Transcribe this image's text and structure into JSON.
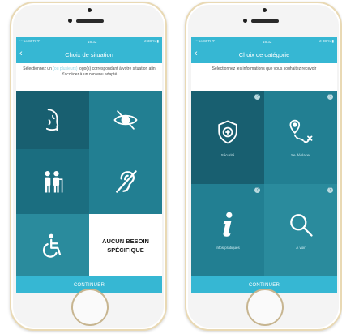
{
  "screen_left": {
    "status": {
      "left": "•••oo SFR ᯤ",
      "time": "16:32",
      "right": "≠ 38 % ▮"
    },
    "title": "Choix de situation",
    "intro_before": "Sélectionnez un",
    "intro_soft": "(ou plusieurs)",
    "intro_after": "logo(s) correspondant à votre situation afin d'accéder à un contenu adapté",
    "tiles": [
      {
        "icon": "face-profile-icon"
      },
      {
        "icon": "eye-icon"
      },
      {
        "icon": "elderly-couple-icon"
      },
      {
        "icon": "hearing-impaired-icon"
      },
      {
        "icon": "wheelchair-icon"
      },
      {
        "line1": "AUCUN BESOIN",
        "line2": "SPÉCIFIQUE"
      }
    ],
    "cta": "CONTINUER"
  },
  "screen_right": {
    "status": {
      "left": "•••oo SFR ᯤ",
      "time": "16:32",
      "right": "≠ 38 % ▮"
    },
    "title": "Choix de catégorie",
    "intro": "Sélectionnez les informations que vous souhaitez recevoir",
    "tiles": [
      {
        "label": "Sécurité",
        "icon": "shield-plus-icon",
        "help": "?"
      },
      {
        "label": "Se déplacer",
        "icon": "route-pin-icon",
        "help": "?"
      },
      {
        "label": "Infos pratiques",
        "icon": "info-icon",
        "help": "?"
      },
      {
        "label": "À voir",
        "icon": "magnifier-icon",
        "help": "?"
      }
    ],
    "cta": "CONTINUER"
  },
  "colors": {
    "accent": "#36b7d3",
    "tile_dark": "#1b6e80",
    "frame_gold": "#e9d9b4"
  }
}
